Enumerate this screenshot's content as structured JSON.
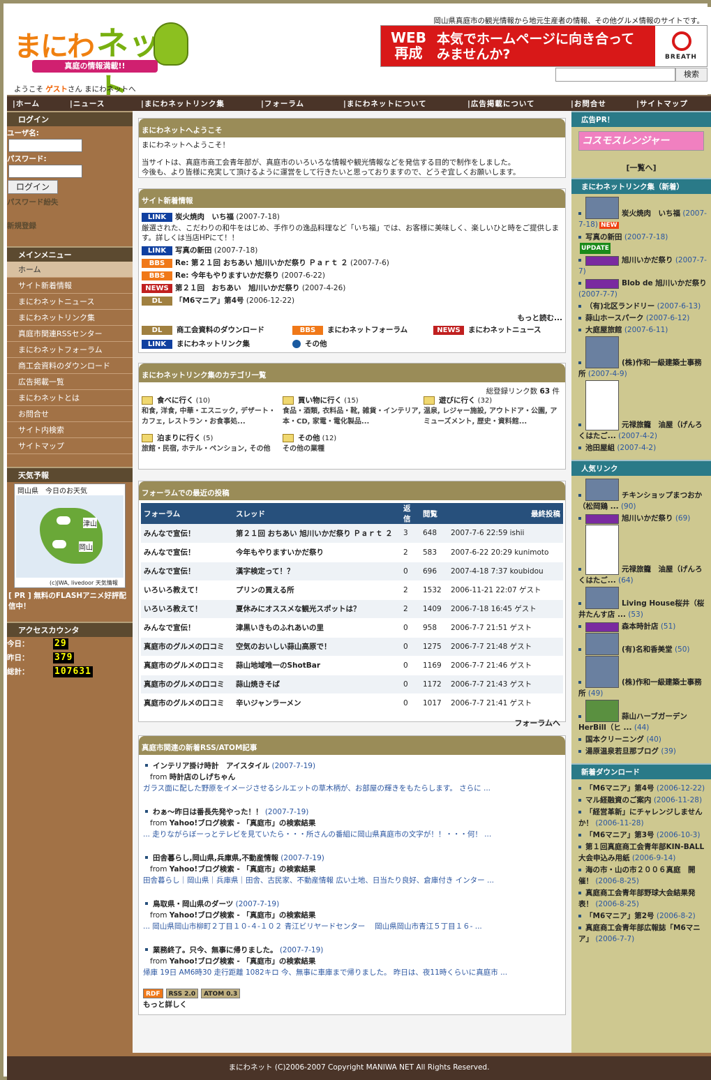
{
  "header": {
    "site_desc": "岡山県真庭市の観光情報から地元生産者の情報、その他グルメ情報のサイトです。",
    "logo_text_1": "まにわ",
    "logo_text_2": "ネット",
    "logo_tagline": "真庭の情報満載!!",
    "banner_text_1": "WEB\n再成",
    "banner_text_2": "本気でホームページに向き合ってみませんか?",
    "banner_brand": "BREATH",
    "search_button": "検索",
    "welcome_prefix": "ようこそ",
    "welcome_user": "ゲスト",
    "welcome_suffix": "さん まにわネットへ"
  },
  "nav": [
    "ホーム",
    "ニュース",
    "まにわネットリンク集",
    "フォーラム",
    "まにわネットについて",
    "広告掲載について",
    "お問合せ",
    "サイトマップ"
  ],
  "left": {
    "login_title": "ログイン",
    "username_label": "ユーザ名:",
    "password_label": "パスワード:",
    "login_button": "ログイン",
    "lost_password": "パスワード紛失",
    "register": "新規登録",
    "menu_title": "メインメニュー",
    "menu": [
      "ホーム",
      "サイト新着情報",
      "まにわネットニュース",
      "まにわネットリンク集",
      "真庭市関連RSSセンター",
      "まにわネットフォーラム",
      "商工会資料のダウンロード",
      "広告掲載一覧",
      "まにわネットとは",
      "お問合せ",
      "サイト内検索",
      "サイトマップ"
    ],
    "weather_title": "天気予報",
    "weather_caption": "岡山県　今日のお天気",
    "weather_city1": "津山",
    "weather_city2": "岡山",
    "weather_credit": "(c)JWA, livedoor 天気情報",
    "pr_text": "[ PR ] 無料のFLASHアニメ好評配信中！",
    "counter_title": "アクセスカウンタ",
    "counter": [
      {
        "label": "今日：",
        "value": "29"
      },
      {
        "label": "昨日：",
        "value": "379"
      },
      {
        "label": "総計：",
        "value": "107631"
      }
    ]
  },
  "welcome_box": {
    "title": "まにわネットへようこそ",
    "line1": "まにわネットへようこそ！",
    "line2": "当サイトは、真庭市商工会青年部が、真庭市のいろいろな情報や観光情報などを発信する目的で制作をしました。",
    "line3": "今後も、より皆様に充実して頂けるように運営をして行きたいと思っておりますので、どうぞ宜しくお願いします。"
  },
  "news_box": {
    "title": "サイト新着情報",
    "items": [
      {
        "tag": "LINK",
        "title": "炭火焼肉　いち福",
        "date": "(2007-7-18)",
        "desc": "厳選された、こだわりの和牛をはじめ、手作りの逸品料理など「いち福」では、お客様に美味しく、楽しいひと時をご提供します。詳しくは当店HPにて！！"
      },
      {
        "tag": "LINK",
        "title": "写真の新田",
        "date": "(2007-7-18)"
      },
      {
        "tag": "BBS",
        "title": "Re: 第２１回 おちあい 旭川いかだ祭り Ｐａｒｔ ２",
        "date": "(2007-7-6)"
      },
      {
        "tag": "BBS",
        "title": "Re: 今年もやりますいかだ祭り",
        "date": "(2007-6-22)"
      },
      {
        "tag": "NEWS",
        "title": "第２１回　おちあい　旭川いかだ祭り",
        "date": "(2007-4-26)"
      },
      {
        "tag": "DL",
        "title": "「M6マニア」第4号",
        "date": "(2006-12-22)"
      }
    ],
    "more": "もっと読む...",
    "legend": [
      {
        "tag": "DL",
        "label": "商工会資料のダウンロード"
      },
      {
        "tag": "BBS",
        "label": "まにわネットフォーラム"
      },
      {
        "tag": "NEWS",
        "label": "まにわネットニュース"
      },
      {
        "tag": "LINK",
        "label": "まにわネットリンク集"
      },
      {
        "tag": "dot",
        "label": "その他"
      }
    ]
  },
  "cat_box": {
    "title": "まにわネットリンク集のカテゴリ一覧",
    "total_prefix": "総登録リンク数",
    "total": "63",
    "total_suffix": "件",
    "cats": [
      {
        "name": "食べに行く",
        "count": "(10)",
        "sub": "和食, 洋食, 中華・エスニック, デザート・カフェ, レストラン・お食事処..."
      },
      {
        "name": "買い物に行く",
        "count": "(15)",
        "sub": "食品・酒類, 衣料品・靴, 雑貨・インテリア, 本・CD, 家電・電化製品..."
      },
      {
        "name": "遊びに行く",
        "count": "(32)",
        "sub": "温泉, レジャー施設, アウトドア・公園, アミューズメント, 歴史・資料館..."
      },
      {
        "name": "泊まりに行く",
        "count": "(5)",
        "sub": "旅館・民宿, ホテル・ペンション, その他"
      },
      {
        "name": "その他",
        "count": "(12)",
        "sub": "その他の業種"
      }
    ]
  },
  "forum_box": {
    "title": "フォーラムでの最近の投稿",
    "headers": [
      "フォーラム",
      "スレッド",
      "返信",
      "閲覧",
      "最終投稿"
    ],
    "rows": [
      [
        "みんなで宣伝！",
        "第２１回 おちあい 旭川いかだ祭り Ｐａｒｔ ２",
        "3",
        "648",
        "2007-7-6 22:59 ishii"
      ],
      [
        "みんなで宣伝！",
        "今年もやりますいかだ祭り",
        "2",
        "583",
        "2007-6-22 20:29 kunimoto"
      ],
      [
        "みんなで宣伝！",
        "漢字検定って！？",
        "0",
        "696",
        "2007-4-18 7:37 koubidou"
      ],
      [
        "いろいろ教えて！",
        "プリンの買える所",
        "2",
        "1532",
        "2006-11-21 22:07 ゲスト"
      ],
      [
        "いろいろ教えて！",
        "夏休みにオススメな観光スポットは？",
        "2",
        "1409",
        "2006-7-18 16:45 ゲスト"
      ],
      [
        "みんなで宣伝！",
        "津黒いきものふれあいの里",
        "0",
        "958",
        "2006-7-7 21:51 ゲスト"
      ],
      [
        "真庭市のグルメの口コミ",
        "空気のおいしい蒜山高原で！",
        "0",
        "1275",
        "2006-7-7 21:48 ゲスト"
      ],
      [
        "真庭市のグルメの口コミ",
        "蒜山地域唯一のShotBar",
        "0",
        "1169",
        "2006-7-7 21:46 ゲスト"
      ],
      [
        "真庭市のグルメの口コミ",
        "蒜山焼きそば",
        "0",
        "1172",
        "2006-7-7 21:43 ゲスト"
      ],
      [
        "真庭市のグルメの口コミ",
        "辛いジャンラーメン",
        "0",
        "1017",
        "2006-7-7 21:41 ゲスト"
      ]
    ],
    "more": "フォーラムへ"
  },
  "rss_box": {
    "title": "真庭市関連の新着RSS/ATOM記事",
    "items": [
      {
        "title": "インテリア掛け時計　アイスタイル",
        "date": "(2007-7-19)",
        "from": "from",
        "source": "時計店のしげちゃん",
        "desc": "ガラス面に配した野原をイメージさせるシルエットの草木柄が、お部屋の輝きをもたらします。 さらに ..."
      },
      {
        "title": "わぁ〜昨日は番長先発やった！！",
        "date": "(2007-7-19)",
        "from": "from",
        "source": "Yahoo!ブログ検索 - 「真庭市」の検索結果",
        "desc": "... 走りながらぼーっとテレビを見ていたら・・・所さんの番組に岡山県真庭市の文字が！！・・・何！ ..."
      },
      {
        "title": "田舎暮らし,岡山県,兵庫県,不動産情報",
        "date": "(2007-7-19)",
        "from": "from",
        "source": "Yahoo!ブログ検索 - 「真庭市」の検索結果",
        "desc": "田舎暮らし｜岡山県｜兵庫県｜田舎、古民家、不動産情報 広い土地、日当たり良好、倉庫付き インター ..."
      },
      {
        "title": "鳥取県・岡山県のダーツ",
        "date": "(2007-7-19)",
        "from": "from",
        "source": "Yahoo!ブログ検索 - 「真庭市」の検索結果",
        "desc": "... 岡山県岡山市柳町２丁目１０-４-１０２ 青江ビリヤードセンター　 岡山県岡山市青江５丁目１６- ..."
      },
      {
        "title": "業務終了。只今、無事に帰りました。",
        "date": "(2007-7-19)",
        "from": "from",
        "source": "Yahoo!ブログ検索 - 「真庭市」の検索結果",
        "desc": "帰庫 19日 AM6時30 走行距離 1082キロ 今、無事に車庫まで帰りました。 昨日は、夜11時くらいに真庭市 ..."
      }
    ],
    "badges": [
      "RDF",
      "RSS 2.0",
      "ATOM 0.3"
    ],
    "more": "もっと詳しく"
  },
  "right": {
    "ad_title": "広告PR！",
    "ad_banner": "コスモスレンジャー",
    "ad_list": "[一覧へ]",
    "links_new_title": "まにわネットリンク集（新着）",
    "links_new": [
      {
        "name": "炭火焼肉　いち福",
        "date": "(2007-7-18)",
        "badge": "NEW"
      },
      {
        "name": "写真の新田",
        "date": "(2007-7-18)",
        "badge": "UPDATE"
      },
      {
        "name": "旭川いかだ祭り",
        "date": "(2007-7-7)"
      },
      {
        "name": "Blob de 旭川いかだ祭り",
        "date": "(2007-7-7)"
      },
      {
        "name": "（有)北区ランドリー",
        "date": "(2007-6-13)"
      },
      {
        "name": "蒜山ホースパーク",
        "date": "(2007-6-12)"
      },
      {
        "name": "大庭屋旅館",
        "date": "(2007-6-11)"
      },
      {
        "name": "(株)作和一級建築士事務所",
        "date": "(2007-4-9)"
      },
      {
        "name": "元禄旅籠　油屋（げんろくはたご...",
        "date": "(2007-4-2)"
      },
      {
        "name": "池田屋組",
        "date": "(2007-4-2)"
      }
    ],
    "popular_title": "人気リンク",
    "popular": [
      {
        "name": "チキンショップまつおか（松岡鶏 ...",
        "count": "(90)"
      },
      {
        "name": "旭川いかだ祭り",
        "count": "(69)"
      },
      {
        "name": "元禄旅籠　油屋（げんろくはたご...",
        "count": "(64)"
      },
      {
        "name": "Living House桜井（桜井たんす店 ...",
        "count": "(53)"
      },
      {
        "name": "森本時計店",
        "count": "(51)"
      },
      {
        "name": "(有)名和香美堂",
        "count": "(50)"
      },
      {
        "name": "(株)作和一級建築士事務所",
        "count": "(49)"
      },
      {
        "name": "蒜山ハーブガーデンHerBill（ヒ ...",
        "count": "(44)"
      },
      {
        "name": "国本クリーニング",
        "count": "(40)"
      },
      {
        "name": "湯原温泉若旦那ブログ",
        "count": "(39)"
      }
    ],
    "downloads_title": "新着ダウンロード",
    "downloads": [
      {
        "name": "「M6マニア」第4号",
        "date": "(2006-12-22)"
      },
      {
        "name": "マル経融資のご案内",
        "date": "(2006-11-28)"
      },
      {
        "name": "「経営革新」にチャレンジしませんか！",
        "date": "(2006-11-28)"
      },
      {
        "name": "「M6マニア」第3号",
        "date": "(2006-10-3)"
      },
      {
        "name": "第１回真庭商工会青年部KIN-BALL大会申込み用紙",
        "date": "(2006-9-14)"
      },
      {
        "name": "海の市・山の市２００６真庭　開催！",
        "date": "(2006-8-25)"
      },
      {
        "name": "真庭商工会青年部野球大会結果発表！",
        "date": "(2006-8-25)"
      },
      {
        "name": "「M6マニア」第2号",
        "date": "(2006-8-2)"
      },
      {
        "name": "真庭商工会青年部広報誌「M6マニア」",
        "date": "(2006-7-7)"
      }
    ]
  },
  "footer": {
    "copyright": "まにわネット (C)2006-2007 Copyright MANIWA NET All Rights Reserved."
  }
}
